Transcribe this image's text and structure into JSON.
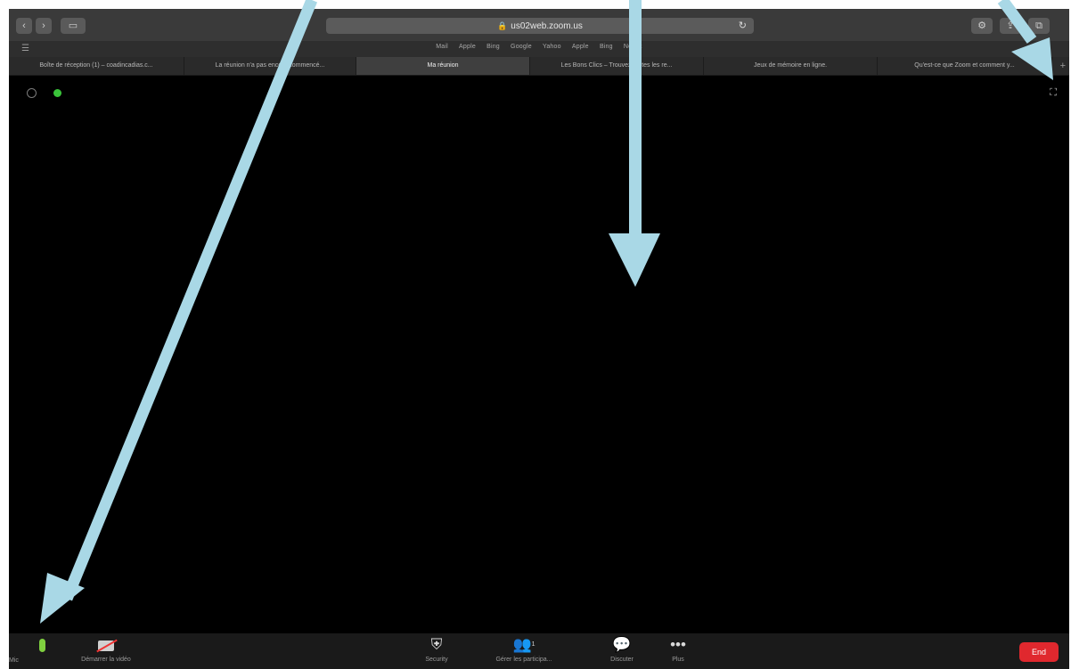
{
  "browser": {
    "url": "us02web.zoom.us",
    "favorites": [
      "Mail",
      "Apple",
      "Bing",
      "Google",
      "Yahoo",
      "Apple",
      "Bing",
      "Netflix"
    ],
    "tabs": [
      {
        "label": "Boîte de réception (1) – coadincadias.c...",
        "active": false
      },
      {
        "label": "La réunion n'a pas encore commencé...",
        "active": false
      },
      {
        "label": "Ma réunion",
        "active": true
      },
      {
        "label": "Les Bons Clics – Trouvez toutes les re...",
        "active": false
      },
      {
        "label": "Jeux de mémoire en ligne.",
        "active": false
      },
      {
        "label": "Qu'est-ce que Zoom et comment y...",
        "active": false
      }
    ]
  },
  "toolbar": {
    "left_clip": "Mic",
    "items": [
      {
        "name": "video",
        "label": "Démarrer la vidéo"
      },
      {
        "name": "security",
        "label": "Security"
      },
      {
        "name": "participants",
        "label": "Gérer les participa...",
        "badge": "1"
      },
      {
        "name": "chat",
        "label": "Discuter"
      },
      {
        "name": "more",
        "label": "Plus"
      }
    ],
    "end_label": "End"
  },
  "colors": {
    "annotation_arrow": "#a9d8e6",
    "end_button": "#e0282e",
    "mic_active": "#7fd03f",
    "status_dot": "#3ac43a"
  }
}
